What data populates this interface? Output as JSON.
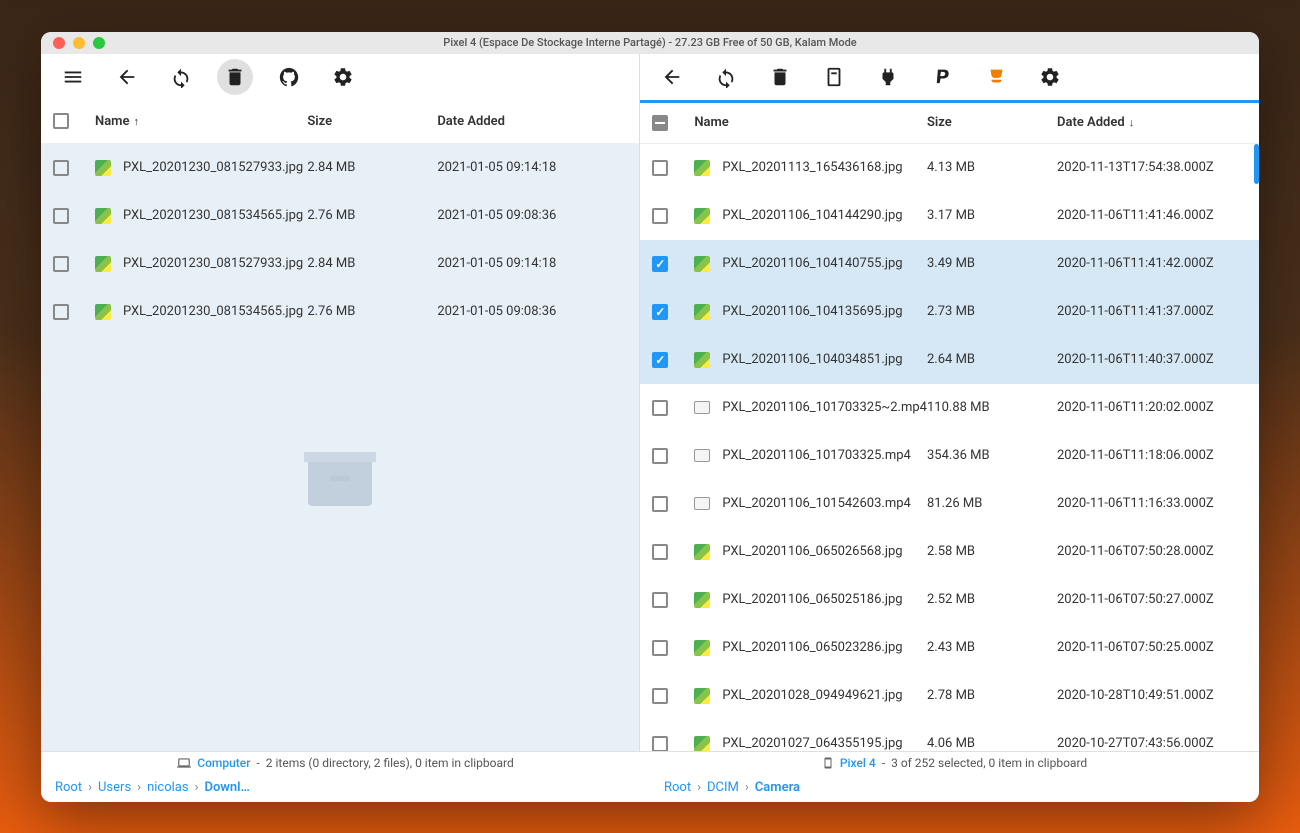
{
  "window": {
    "title": "Pixel 4 (Espace De Stockage Interne Partagé) - 27.23 GB Free of 50 GB, Kalam Mode"
  },
  "left": {
    "columns": {
      "name": "Name",
      "size": "Size",
      "date": "Date Added"
    },
    "sort": {
      "col": "name",
      "dir": "asc"
    },
    "rows": [
      {
        "name": "PXL_20201230_081527933.jpg",
        "size": "2.84 MB",
        "date": "2021-01-05 09:14:18",
        "type": "img",
        "selected": false
      },
      {
        "name": "PXL_20201230_081534565.jpg",
        "size": "2.76 MB",
        "date": "2021-01-05 09:08:36",
        "type": "img",
        "selected": false
      }
    ],
    "footer": {
      "device": "Computer",
      "status": "2 items (0 directory, 2 files), 0 item in clipboard"
    },
    "breadcrumbs": [
      "Root",
      "Users",
      "nicolas",
      "Downl…"
    ]
  },
  "right": {
    "columns": {
      "name": "Name",
      "size": "Size",
      "date": "Date Added"
    },
    "sort": {
      "col": "date",
      "dir": "desc"
    },
    "header_check": "indeterminate",
    "rows": [
      {
        "name": "PXL_20201113_165436168.jpg",
        "size": "4.13 MB",
        "date": "2020-11-13T17:54:38.000Z",
        "type": "img",
        "selected": false
      },
      {
        "name": "PXL_20201106_104144290.jpg",
        "size": "3.17 MB",
        "date": "2020-11-06T11:41:46.000Z",
        "type": "img",
        "selected": false
      },
      {
        "name": "PXL_20201106_104140755.jpg",
        "size": "3.49 MB",
        "date": "2020-11-06T11:41:42.000Z",
        "type": "img",
        "selected": true
      },
      {
        "name": "PXL_20201106_104135695.jpg",
        "size": "2.73 MB",
        "date": "2020-11-06T11:41:37.000Z",
        "type": "img",
        "selected": true
      },
      {
        "name": "PXL_20201106_104034851.jpg",
        "size": "2.64 MB",
        "date": "2020-11-06T11:40:37.000Z",
        "type": "img",
        "selected": true
      },
      {
        "name": "PXL_20201106_101703325~2.mp4",
        "size": "110.88 MB",
        "date": "2020-11-06T11:20:02.000Z",
        "type": "vid",
        "selected": false
      },
      {
        "name": "PXL_20201106_101703325.mp4",
        "size": "354.36 MB",
        "date": "2020-11-06T11:18:06.000Z",
        "type": "vid",
        "selected": false
      },
      {
        "name": "PXL_20201106_101542603.mp4",
        "size": "81.26 MB",
        "date": "2020-11-06T11:16:33.000Z",
        "type": "vid",
        "selected": false
      },
      {
        "name": "PXL_20201106_065026568.jpg",
        "size": "2.58 MB",
        "date": "2020-11-06T07:50:28.000Z",
        "type": "img",
        "selected": false
      },
      {
        "name": "PXL_20201106_065025186.jpg",
        "size": "2.52 MB",
        "date": "2020-11-06T07:50:27.000Z",
        "type": "img",
        "selected": false
      },
      {
        "name": "PXL_20201106_065023286.jpg",
        "size": "2.43 MB",
        "date": "2020-11-06T07:50:25.000Z",
        "type": "img",
        "selected": false
      },
      {
        "name": "PXL_20201028_094949621.jpg",
        "size": "2.78 MB",
        "date": "2020-10-28T10:49:51.000Z",
        "type": "img",
        "selected": false
      },
      {
        "name": "PXL_20201027_064355195.jpg",
        "size": "4.06 MB",
        "date": "2020-10-27T07:43:56.000Z",
        "type": "img",
        "selected": false
      }
    ],
    "footer": {
      "device": "Pixel 4",
      "status": "3 of 252 selected, 0 item in clipboard"
    },
    "breadcrumbs": [
      "Root",
      "DCIM",
      "Camera"
    ]
  }
}
